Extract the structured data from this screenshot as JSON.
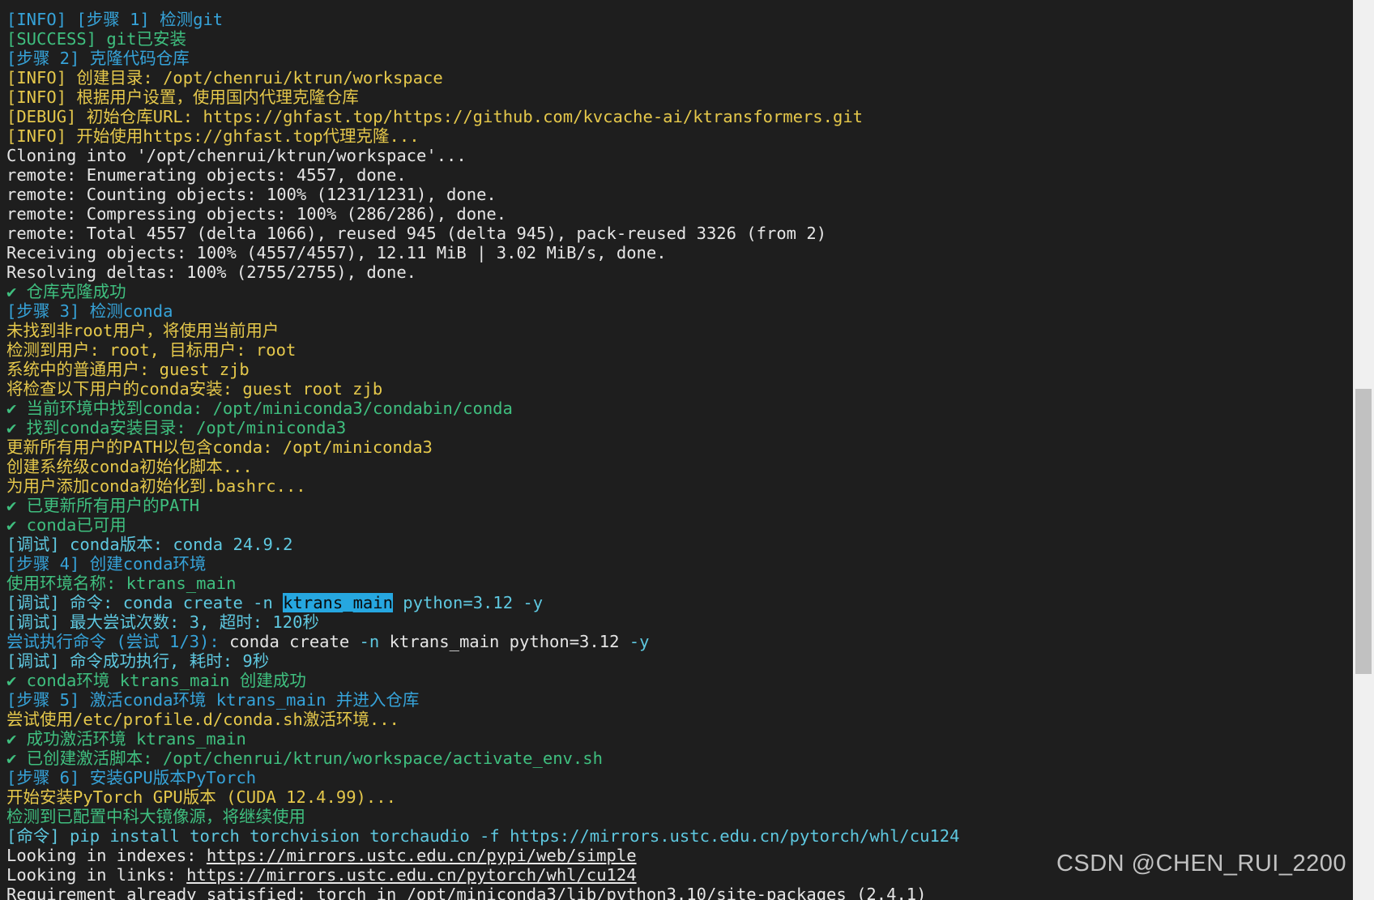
{
  "terminal": {
    "lines": [
      [
        {
          "t": "[INFO] [步骤 1] 检测git",
          "c": "blue"
        }
      ],
      [
        {
          "t": "[SUCCESS] git已安装",
          "c": "green"
        }
      ],
      [
        {
          "t": "[步骤 2] 克隆代码仓库",
          "c": "blue"
        }
      ],
      [
        {
          "t": "[INFO] 创建目录: /opt/chenrui/ktrun/workspace",
          "c": "yellow"
        }
      ],
      [
        {
          "t": "[INFO] 根据用户设置，使用国内代理克隆仓库",
          "c": "yellow"
        }
      ],
      [
        {
          "t": "[DEBUG] 初始仓库URL: https://ghfast.top/https://github.com/kvcache-ai/ktransformers.git",
          "c": "yellow"
        }
      ],
      [
        {
          "t": "[INFO] 开始使用https://ghfast.top代理克隆...",
          "c": "yellow"
        }
      ],
      [
        {
          "t": "Cloning into '/opt/chenrui/ktrun/workspace'...",
          "c": "white"
        }
      ],
      [
        {
          "t": "remote: Enumerating objects: 4557, done.",
          "c": "white"
        }
      ],
      [
        {
          "t": "remote: Counting objects: 100% (1231/1231), done.",
          "c": "white"
        }
      ],
      [
        {
          "t": "remote: Compressing objects: 100% (286/286), done.",
          "c": "white"
        }
      ],
      [
        {
          "t": "remote: Total 4557 (delta 1066), reused 945 (delta 945), pack-reused 3326 (from 2)",
          "c": "white"
        }
      ],
      [
        {
          "t": "Receiving objects: 100% (4557/4557), 12.11 MiB | 3.02 MiB/s, done.",
          "c": "white"
        }
      ],
      [
        {
          "t": "Resolving deltas: 100% (2755/2755), done.",
          "c": "white"
        }
      ],
      [
        {
          "t": "✔ 仓库克隆成功",
          "c": "green"
        }
      ],
      [
        {
          "t": "[步骤 3] 检测conda",
          "c": "blue"
        }
      ],
      [
        {
          "t": "未找到非root用户，将使用当前用户",
          "c": "yellow"
        }
      ],
      [
        {
          "t": "检测到用户: root, 目标用户: root",
          "c": "yellow"
        }
      ],
      [
        {
          "t": "系统中的普通用户: guest zjb",
          "c": "yellow"
        }
      ],
      [
        {
          "t": "将检查以下用户的conda安装: guest root zjb",
          "c": "yellow"
        }
      ],
      [
        {
          "t": "✔ 当前环境中找到conda: /opt/miniconda3/condabin/conda",
          "c": "green"
        }
      ],
      [
        {
          "t": "✔ 找到conda安装目录: /opt/miniconda3",
          "c": "green"
        }
      ],
      [
        {
          "t": "更新所有用户的PATH以包含conda: /opt/miniconda3",
          "c": "yellow"
        }
      ],
      [
        {
          "t": "创建系统级conda初始化脚本...",
          "c": "yellow"
        }
      ],
      [
        {
          "t": "为用户添加conda初始化到.bashrc...",
          "c": "yellow"
        }
      ],
      [
        {
          "t": "✔ 已更新所有用户的PATH",
          "c": "green"
        }
      ],
      [
        {
          "t": "✔ conda已可用",
          "c": "green"
        }
      ],
      [
        {
          "t": "[调试] conda版本: conda 24.9.2",
          "c": "cyan"
        }
      ],
      [
        {
          "t": "[步骤 4] 创建conda环境",
          "c": "blue"
        }
      ],
      [
        {
          "t": "使用环境名称: ktrans_main",
          "c": "green"
        }
      ],
      [
        {
          "t": "[调试] 命令: conda create -n ",
          "c": "cyan"
        },
        {
          "t": "ktrans_main",
          "c": "sel"
        },
        {
          "t": " python=3.12 -y",
          "c": "cyan"
        }
      ],
      [
        {
          "t": "[调试] 最大尝试次数: 3, 超时: 120秒",
          "c": "cyan"
        }
      ],
      [
        {
          "t": "尝试执行命令 (尝试 1/3): ",
          "c": "blue"
        },
        {
          "t": "conda create ",
          "c": "white"
        },
        {
          "t": "-n ",
          "c": "cyan"
        },
        {
          "t": "ktrans_main python=3.12 ",
          "c": "white"
        },
        {
          "t": "-y",
          "c": "cyan"
        }
      ],
      [
        {
          "t": "[调试] 命令成功执行, 耗时: 9秒",
          "c": "cyan"
        }
      ],
      [
        {
          "t": "✔ conda环境 ktrans_main 创建成功",
          "c": "green"
        }
      ],
      [
        {
          "t": "[步骤 5] 激活conda环境 ktrans_main 并进入仓库",
          "c": "blue"
        }
      ],
      [
        {
          "t": "尝试使用/etc/profile.d/conda.sh激活环境...",
          "c": "yellow"
        }
      ],
      [
        {
          "t": "✔ 成功激活环境 ktrans_main",
          "c": "green"
        }
      ],
      [
        {
          "t": "✔ 已创建激活脚本: /opt/chenrui/ktrun/workspace/activate_env.sh",
          "c": "green"
        }
      ],
      [
        {
          "t": "[步骤 6] 安装GPU版本PyTorch",
          "c": "blue"
        }
      ],
      [
        {
          "t": "开始安装PyTorch GPU版本 (CUDA 12.4.99)...",
          "c": "yellow"
        }
      ],
      [
        {
          "t": "检测到已配置中科大镜像源，将继续使用",
          "c": "green"
        }
      ],
      [
        {
          "t": "[命令] pip install torch torchvision torchaudio -f https://mirrors.ustc.edu.cn/pytorch/whl/cu124",
          "c": "cyan"
        }
      ],
      [
        {
          "t": "Looking in indexes: ",
          "c": "white"
        },
        {
          "t": "https://mirrors.ustc.edu.cn/pypi/web/simple",
          "c": "link"
        }
      ],
      [
        {
          "t": "Looking in links: ",
          "c": "white"
        },
        {
          "t": "https://mirrors.ustc.edu.cn/pytorch/whl/cu124",
          "c": "link"
        }
      ],
      [
        {
          "t": "Requirement already satisfied: torch in /opt/miniconda3/lib/python3.10/site-packages (2.4.1)",
          "c": "white"
        }
      ]
    ]
  },
  "watermark": {
    "text": "CSDN @CHEN_RUI_2200"
  },
  "colors": {
    "background": "#1e1e1e",
    "info_blue": "#36a3d9",
    "success_green": "#3fbf7f",
    "warning_yellow": "#e5c84b",
    "debug_cyan": "#5ec8e0",
    "selection": "#26a7e0"
  }
}
